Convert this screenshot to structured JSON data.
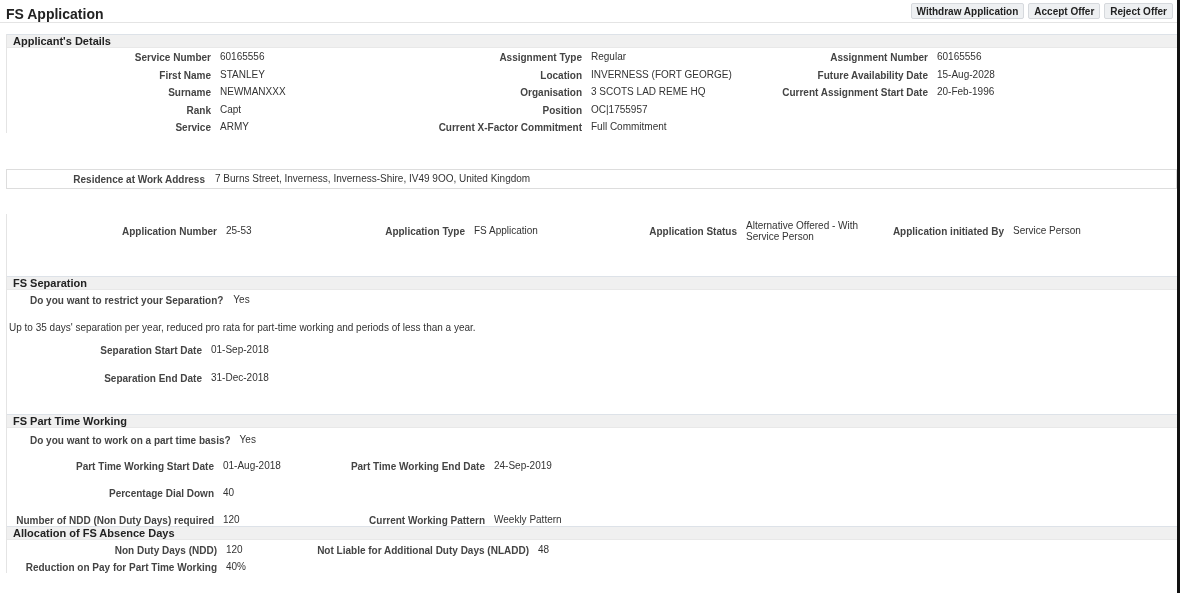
{
  "title": "FS Application",
  "actions": [
    "Withdraw Application",
    "Accept Offer",
    "Reject Offer"
  ],
  "applicant": {
    "heading": "Applicant's Details",
    "columns": [
      [
        {
          "label": "Service Number",
          "value": "60165556"
        },
        {
          "label": "First Name",
          "value": "STANLEY"
        },
        {
          "label": "Surname",
          "value": "NEWMANXXX"
        },
        {
          "label": "Rank",
          "value": "Capt"
        },
        {
          "label": "Service",
          "value": "ARMY"
        }
      ],
      [
        {
          "label": "Assignment Type",
          "value": "Regular"
        },
        {
          "label": "Location",
          "value": "INVERNESS (FORT GEORGE)"
        },
        {
          "label": "Organisation",
          "value": "3 SCOTS LAD REME HQ"
        },
        {
          "label": "Position",
          "value": "OC|1755957"
        },
        {
          "label": "Current X-Factor Commitment",
          "value": "Full Commitment"
        }
      ],
      [
        {
          "label": "Assignment Number",
          "value": "60165556"
        },
        {
          "label": "Future Availability Date",
          "value": "15-Aug-2028"
        },
        {
          "label": "Current Assignment Start Date",
          "value": "20-Feb-1996"
        }
      ]
    ]
  },
  "residence": {
    "label": "Residence at Work Address",
    "value": "7 Burns Street, Inverness, Inverness-Shire, IV49 9OO, United Kingdom"
  },
  "application": [
    {
      "label": "Application Number",
      "value": "25-53"
    },
    {
      "label": "Application Type",
      "value": "FS Application"
    },
    {
      "label": "Application Status",
      "value": "Alternative Offered - With Service Person"
    },
    {
      "label": "Application initiated By",
      "value": "Service Person"
    }
  ],
  "separation": {
    "heading": "FS Separation",
    "question": {
      "label": "Do you want to restrict your Separation?",
      "value": "Yes"
    },
    "note": "Up to 35 days' separation per year, reduced pro rata for part-time working and periods of less than a year.",
    "fields": [
      {
        "label": "Separation Start Date",
        "value": "01-Sep-2018"
      },
      {
        "label": "Separation End Date",
        "value": "31-Dec-2018"
      }
    ]
  },
  "part_time": {
    "heading": "FS Part Time Working",
    "question": {
      "label": "Do you want to work on a part time basis?",
      "value": "Yes"
    },
    "rows": [
      [
        {
          "label": "Part Time Working Start Date",
          "value": "01-Aug-2018"
        },
        {
          "label": "Part Time Working End Date",
          "value": "24-Sep-2019"
        }
      ],
      [
        {
          "label": "Percentage Dial Down",
          "value": "40"
        }
      ],
      [
        {
          "label": "Number of NDD (Non Duty Days) required",
          "value": "120"
        },
        {
          "label": "Current Working Pattern",
          "value": "Weekly Pattern"
        }
      ]
    ]
  },
  "allocation": {
    "heading": "Allocation of FS Absence Days",
    "rows": [
      [
        {
          "label": "Non Duty Days (NDD)",
          "value": "120"
        },
        {
          "label": "Not Liable for Additional Duty Days (NLADD)",
          "value": "48"
        }
      ],
      [
        {
          "label": "Reduction on Pay for Part Time Working",
          "value": "40%"
        }
      ]
    ]
  }
}
